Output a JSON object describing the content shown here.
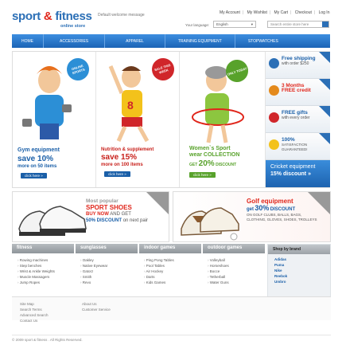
{
  "logo": {
    "word1": "sport",
    "amp": "&",
    "word2": "fitness",
    "tagline": "online store"
  },
  "welcome": "Default welcome message",
  "toplinks": [
    "My Account",
    "My Wishlist",
    "My Cart",
    "Checkout",
    "Log In"
  ],
  "language": {
    "label": "Your language:",
    "value": "English"
  },
  "search": {
    "placeholder": "Search entire store here"
  },
  "nav": [
    "HOME",
    "ACCESSORIES",
    "APPAREL",
    "TRAINING EQUIPMENT",
    "STOPWATCHES"
  ],
  "banner": {
    "col1": {
      "badge": "ONLINE SPORTS",
      "title": "Gym equipment",
      "save": "save 10%",
      "more": "more on 50 items",
      "btn": "click here »"
    },
    "col2": {
      "badge": "SALE THIS WEEK",
      "title": "Nutrition & supplement",
      "save": "save 15%",
      "more": "more on 100 items",
      "btn": "click here »"
    },
    "col3": {
      "badge": "ONLY TODAY",
      "title": "Women`s Sport",
      "sub": "wear COLLECTION",
      "get": "GET",
      "pct": "20%",
      "disc": "DISCOUNT",
      "btn": "click here »"
    },
    "side": [
      {
        "big": "Free shipping",
        "small": "with order $250"
      },
      {
        "big": "3 Months",
        "big2": "FREE credit"
      },
      {
        "big": "FREE gifts",
        "small": "with every order"
      },
      {
        "big": "100%",
        "small": "SATISFACTION GUARANTEED!"
      }
    ],
    "cricket": {
      "line1": "Cricket equipment",
      "line2": "15% discount »"
    }
  },
  "promo1": {
    "l1": "Most popular",
    "l2": "SPORT SHOES",
    "l3": "BUY NOW",
    "l4": "AND GET",
    "l5": "50% DISCOUNT",
    "l6": "on next pair",
    "tag": "special offer"
  },
  "promo2": {
    "l1": "Golf equipment",
    "l2": "get",
    "l3": "30%",
    "l4": "DISCOUNT",
    "l5": "ON GOLF CLUBS, BALLS, BAGS,",
    "l6": "CLOTHING, GLOVES, SHOES, TROLLEYS",
    "tag": "special offer"
  },
  "footer_tabs": [
    "fitness",
    "sunglasses",
    "indoor games",
    "outdoor games"
  ],
  "footer_cols": [
    [
      "Rowing machines",
      "Step benches",
      "Wrist & Ankle Weights",
      "Muscle Massagers",
      "Jump Ropes"
    ],
    [
      "Oakley",
      "Native Eyewear",
      "Gatorz",
      "Smith",
      "Revo"
    ],
    [
      "Ping Pong Tables",
      "Pool Tables",
      "Air Hockey",
      "Darts",
      "Kids Games"
    ],
    [
      "Volleyball",
      "Horseshoes",
      "Bocce",
      "Tetherball",
      "Water Guns"
    ]
  ],
  "shop_by_brand": {
    "title": "Shop by brand",
    "items": [
      "Adidas",
      "Puma",
      "Nike",
      "Reebok",
      "Umbro"
    ]
  },
  "footer_links": {
    "col1": [
      "Site Map",
      "Search Terms",
      "Advanced Search",
      "Contact Us"
    ],
    "col2": [
      "About Us",
      "Customer Service"
    ]
  },
  "copyright": "© 2009  sport & fitness . All Rights Reserved.",
  "colors": {
    "brand_blue": "#2b6fb6",
    "brand_red": "#e0261b",
    "green": "#58a22b"
  }
}
